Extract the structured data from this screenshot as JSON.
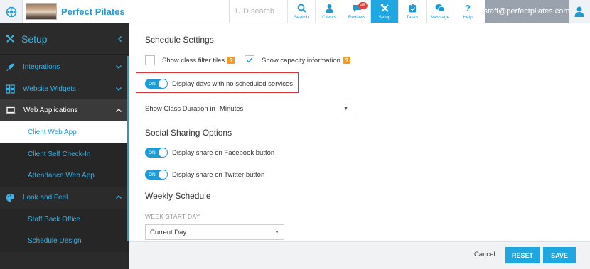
{
  "header": {
    "brand": "Perfect Pilates",
    "uid_placeholder": "UID search",
    "nav": [
      {
        "label": "Search",
        "icon": "search-icon"
      },
      {
        "label": "Clients",
        "icon": "user-icon"
      },
      {
        "label": "Reviews",
        "icon": "chat-icon",
        "badge": "48"
      },
      {
        "label": "Setup",
        "icon": "tools-icon",
        "active": true
      },
      {
        "label": "Tasks",
        "icon": "clipboard-icon"
      },
      {
        "label": "Message",
        "icon": "message-icon"
      },
      {
        "label": "Help",
        "icon": "question-icon"
      }
    ],
    "user_email": "staff@perfectpilates.com"
  },
  "sidebar": {
    "title": "Setup",
    "items": [
      {
        "label": "Integrations"
      },
      {
        "label": "Website Widgets"
      },
      {
        "label": "Web Applications"
      },
      {
        "label": "Client Web App"
      },
      {
        "label": "Client Self Check-In"
      },
      {
        "label": "Attendance Web App"
      },
      {
        "label": "Look and Feel"
      },
      {
        "label": "Staff Back Office"
      },
      {
        "label": "Schedule Design"
      }
    ]
  },
  "main": {
    "schedule_settings_title": "Schedule Settings",
    "show_class_filter_tiles": "Show class filter tiles",
    "show_capacity_information": "Show capacity information",
    "toggle_on_label": "ON",
    "display_days_no_services": "Display days with no scheduled services",
    "show_class_duration_label": "Show Class Duration in",
    "duration_value": "Minutes",
    "social_title": "Social Sharing Options",
    "facebook_label": "Display share on Facebook button",
    "twitter_label": "Display share on Twitter button",
    "weekly_title": "Weekly Schedule",
    "week_start_label": "WEEK START DAY",
    "week_start_value": "Current Day"
  },
  "footer": {
    "cancel": "Cancel",
    "reset": "RESET",
    "save": "SAVE"
  },
  "colors": {
    "accent": "#1ea7e0",
    "sidebar_bg": "#2b2b2b",
    "help_orange": "#f59b23",
    "highlight_red": "#dd3333"
  }
}
